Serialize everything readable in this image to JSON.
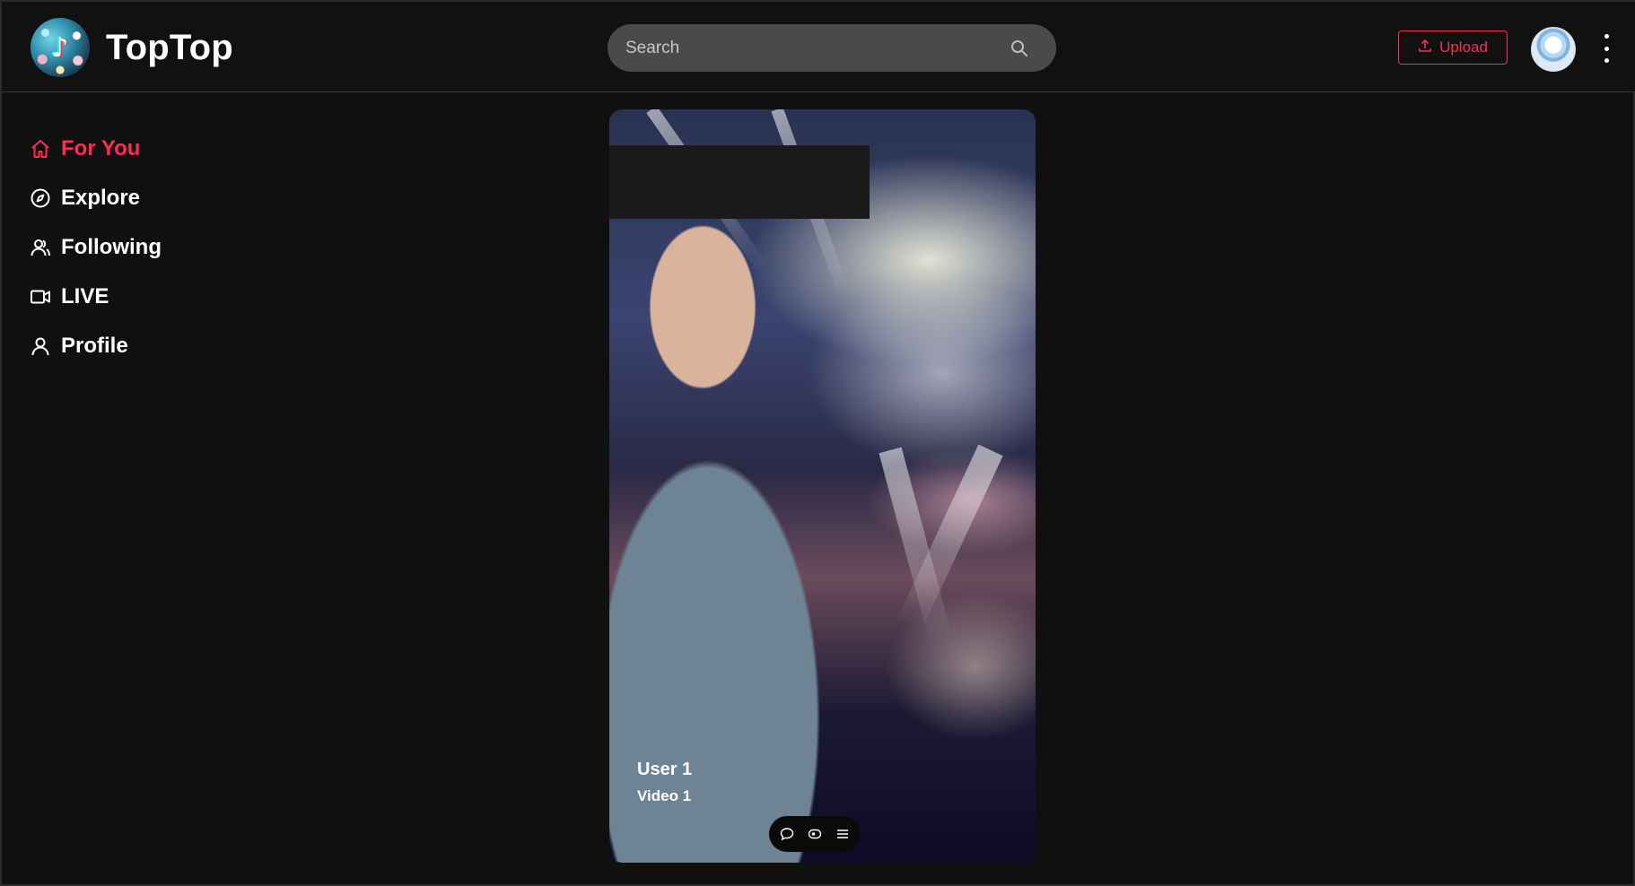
{
  "brand": {
    "name": "TopTop",
    "logo_icon": "music-note-logo"
  },
  "search": {
    "placeholder": "Search",
    "icon": "search-icon"
  },
  "header": {
    "upload_label": "Upload",
    "upload_icon": "upload-icon",
    "more_icon": "vertical-dots-icon"
  },
  "colors": {
    "accent": "#fe2c55",
    "background": "#101010",
    "search_bg": "#4a4a4a"
  },
  "sidebar": {
    "items": [
      {
        "label": "For You",
        "icon": "home-icon",
        "active": true
      },
      {
        "label": "Explore",
        "icon": "compass-icon",
        "active": false
      },
      {
        "label": "Following",
        "icon": "users-icon",
        "active": false
      },
      {
        "label": "LIVE",
        "icon": "video-camera-icon",
        "active": false
      },
      {
        "label": "Profile",
        "icon": "user-icon",
        "active": false
      }
    ]
  },
  "video": {
    "user": "User 1",
    "title": "Video 1",
    "controls": [
      "comment-icon",
      "eye-icon",
      "menu-icon"
    ]
  }
}
